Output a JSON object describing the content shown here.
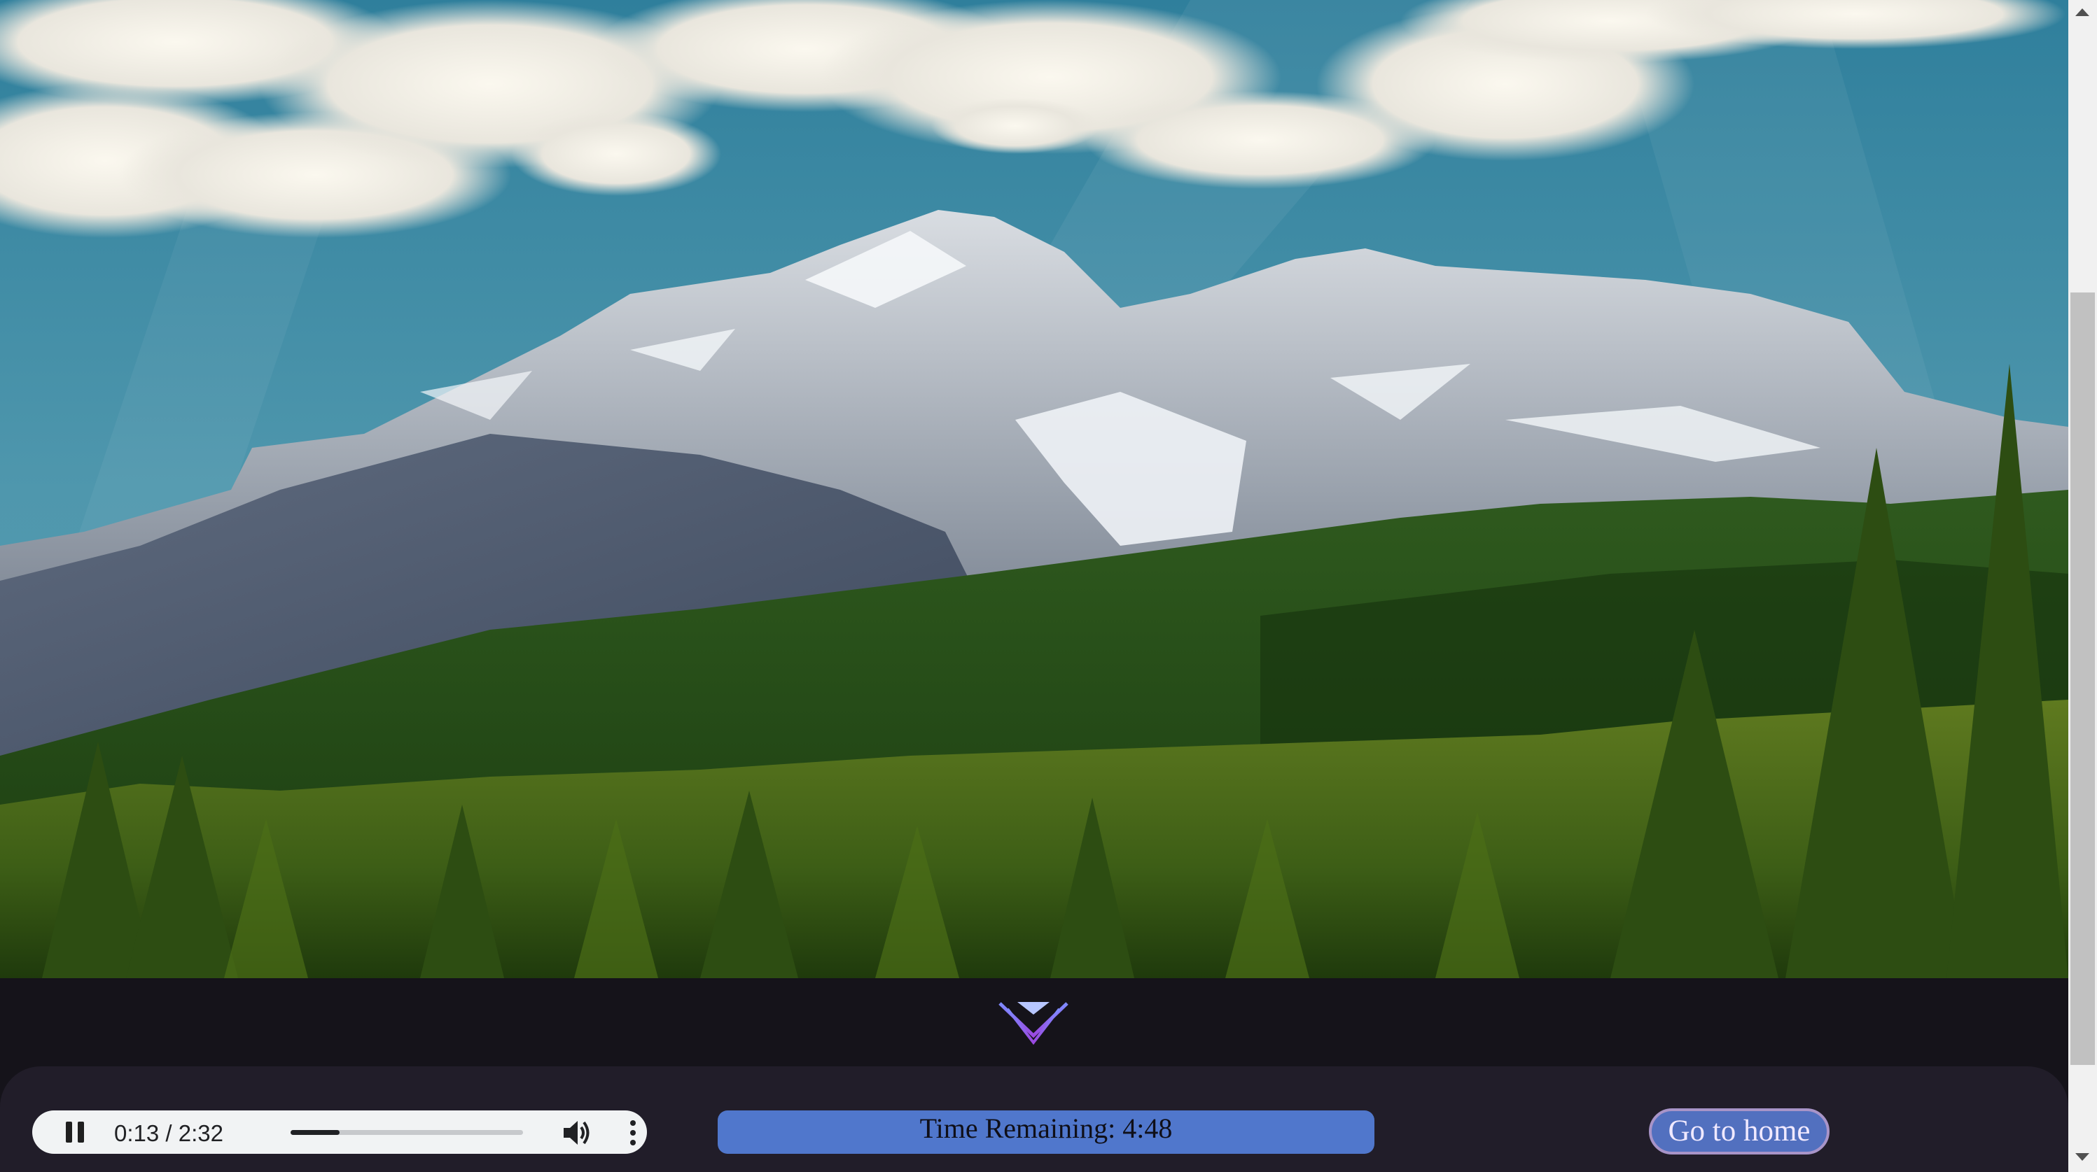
{
  "background": {
    "description_icon": "mountain-landscape-image"
  },
  "scroll_indicator": {
    "icon": "chevron-down-icon",
    "colors": {
      "top": "#7e8bff",
      "bottom": "#9a48e0"
    }
  },
  "audio_player": {
    "play_state_icon": "pause-icon",
    "current_time": "0:13",
    "duration": "2:32",
    "time_text": "0:13 / 2:32",
    "progress_fraction": 0.21,
    "volume_icon": "volume-icon",
    "more_icon": "more-options-icon"
  },
  "timer": {
    "text": "Time Remaining: 4:48",
    "color": "#5077cc"
  },
  "home_button": {
    "label": "Go to home",
    "color": "#5270bf",
    "border_color": "#a894c8"
  },
  "scrollbar": {
    "up_icon": "scroll-up-arrow-icon",
    "down_icon": "scroll-down-arrow-icon"
  }
}
